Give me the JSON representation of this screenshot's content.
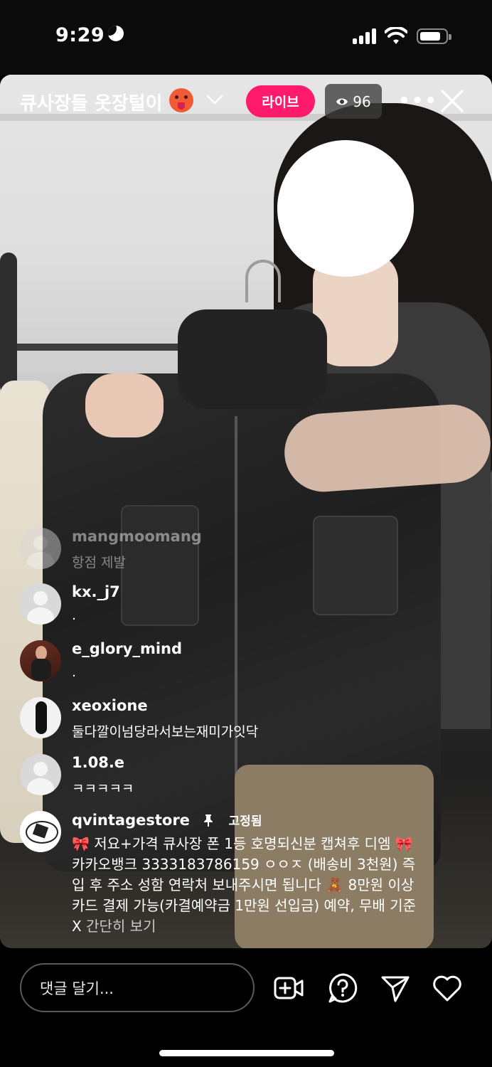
{
  "status_bar": {
    "time": "9:29",
    "icons": [
      "moon-icon",
      "signal-icon",
      "wifi-icon",
      "battery-icon"
    ]
  },
  "live": {
    "title": "큐사장들 옷장털이",
    "title_emoji": "hot-face-emoji",
    "badge": "라이브",
    "viewer_count": "96",
    "accent": "#ff1a6c"
  },
  "comments": [
    {
      "user": "mangmoomang",
      "text": "항점 제발",
      "avatar": "faded"
    },
    {
      "user": "kx._j7",
      "text": ".",
      "avatar": "default"
    },
    {
      "user": "e_glory_mind",
      "text": ".",
      "avatar": "photo"
    },
    {
      "user": "xeoxione",
      "text": "둘다깔이넘당라서보는재미가잇닥",
      "avatar": "photo"
    },
    {
      "user": "1.08.e",
      "text": "ㅋㅋㅋㅋㅋ",
      "avatar": "default"
    }
  ],
  "pinned": {
    "user": "qvintagestore",
    "pin_label": "고정됨",
    "lines": [
      "🎀 저요+가격 큐사장 폰 1등 호명되신분 캡쳐후 디엠 🎀",
      "카카오뱅크 3333183786159 ㅇㅇㅈ (배송비 3천원) 즉",
      "입 후 주소 성함 연락처 보내주시면 됩니다 🧸 8만원 이상",
      "카드 결제 가능(카결예약금 1만원 선입금) 예약, 무배 기준"
    ],
    "last_line_prefix": "X ",
    "collapse_label": "간단히 보기"
  },
  "bottom": {
    "comment_placeholder": "댓글 달기..."
  }
}
